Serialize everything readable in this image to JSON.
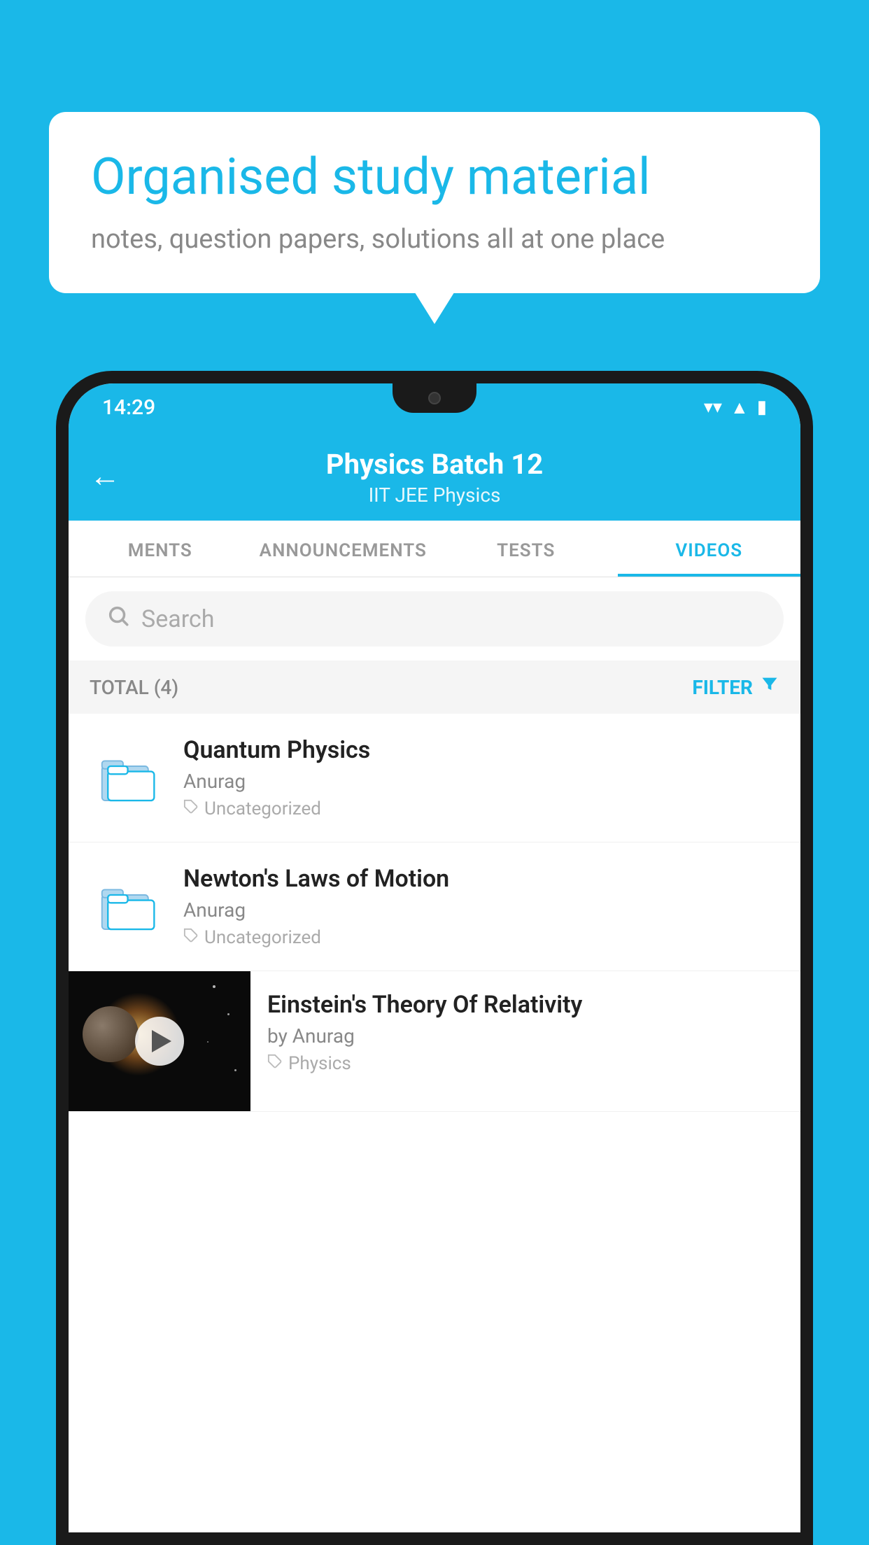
{
  "background_color": "#1ab8e8",
  "bubble": {
    "title": "Organised study material",
    "subtitle": "notes, question papers, solutions all at one place"
  },
  "status_bar": {
    "time": "14:29",
    "wifi": "▼",
    "signal": "▲",
    "battery": "▮"
  },
  "app_header": {
    "title": "Physics Batch 12",
    "subtitle": "IIT JEE   Physics",
    "back_label": "←"
  },
  "tabs": [
    {
      "label": "MENTS",
      "active": false
    },
    {
      "label": "ANNOUNCEMENTS",
      "active": false
    },
    {
      "label": "TESTS",
      "active": false
    },
    {
      "label": "VIDEOS",
      "active": true
    }
  ],
  "search": {
    "placeholder": "Search"
  },
  "filter_bar": {
    "total_label": "TOTAL (4)",
    "filter_label": "FILTER"
  },
  "videos": [
    {
      "id": 1,
      "title": "Quantum Physics",
      "author": "Anurag",
      "tag": "Uncategorized",
      "type": "folder"
    },
    {
      "id": 2,
      "title": "Newton's Laws of Motion",
      "author": "Anurag",
      "tag": "Uncategorized",
      "type": "folder"
    },
    {
      "id": 3,
      "title": "Einstein's Theory Of Relativity",
      "author": "by Anurag",
      "tag": "Physics",
      "type": "thumbnail"
    }
  ]
}
